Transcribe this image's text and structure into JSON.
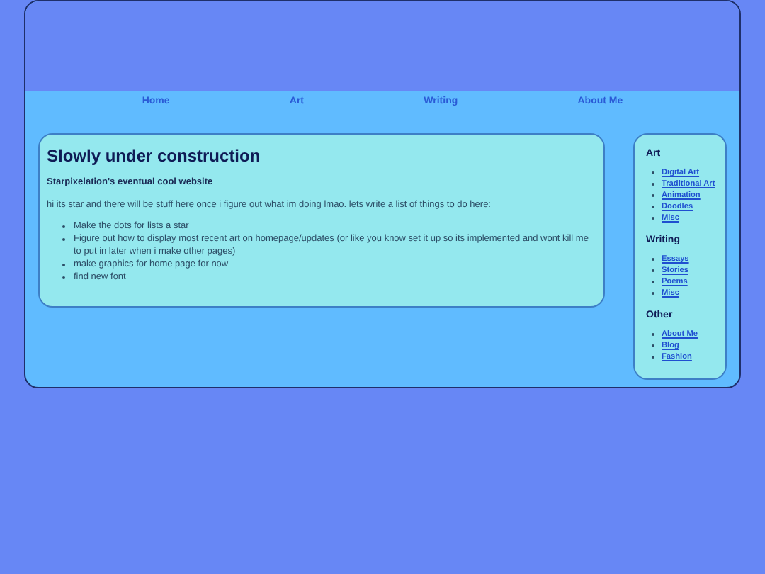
{
  "nav": [
    "Home",
    "Art",
    "Writing",
    "About Me"
  ],
  "main": {
    "title": "Slowly under construction",
    "subtitle": "Starpixelation's eventual cool website",
    "intro": "hi its star and there will be stuff here once i figure out what im doing lmao. lets write a list of things to do here:",
    "todo": [
      "Make the dots for lists a star",
      "Figure out how to display most recent art on homepage/updates (or like you know set it up so its implemented and wont kill me to put in later when i make other pages)",
      "make graphics for home page for now",
      "find new font"
    ]
  },
  "sidebar": [
    {
      "heading": "Art",
      "links": [
        "Digital Art",
        "Traditional Art",
        "Animation",
        "Doodles",
        "Misc"
      ]
    },
    {
      "heading": "Writing",
      "links": [
        "Essays",
        "Stories",
        "Poems",
        "Misc"
      ]
    },
    {
      "heading": "Other",
      "links": [
        "About Me",
        "Blog",
        "Fashion"
      ]
    }
  ]
}
